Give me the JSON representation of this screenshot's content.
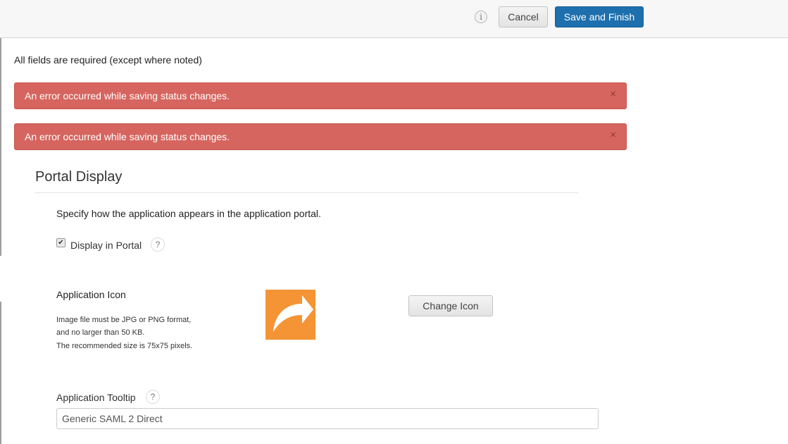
{
  "header": {
    "info_icon_glyph": "i",
    "cancel_label": "Cancel",
    "save_label": "Save and Finish"
  },
  "form": {
    "required_note": "All fields are required (except where noted)",
    "alerts": [
      {
        "message": "An error occurred while saving status changes.",
        "close": "×"
      },
      {
        "message": "An error occurred while saving status changes.",
        "close": "×"
      }
    ]
  },
  "portal_display": {
    "title": "Portal Display",
    "description": "Specify how the application appears in the application portal.",
    "display_in_portal_label": "Display in Portal",
    "display_in_portal_checked": true,
    "help_glyph": "?",
    "application_icon": {
      "heading": "Application Icon",
      "notes": [
        "Image file must be JPG or PNG format,",
        "and no larger than 50 KB.",
        "The recommended size is 75x75 pixels."
      ],
      "icon_name": "share-arrow-icon",
      "icon_color": "#f49434",
      "change_label": "Change Icon"
    },
    "tooltip": {
      "label": "Application Tooltip",
      "value": "Generic SAML 2 Direct"
    }
  },
  "colors": {
    "primary_button": "#1e6fad",
    "error_alert": "#d6655f"
  }
}
